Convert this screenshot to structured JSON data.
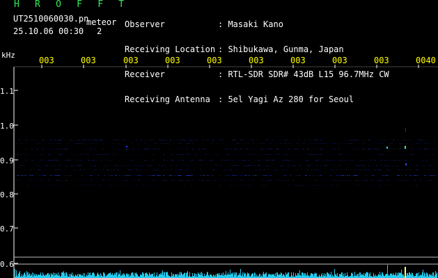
{
  "header": {
    "title": "H R O F F T",
    "filename": "UT2510060030.pn",
    "type_label": "meteor",
    "datetime": "25.10.06 00:30",
    "count": "2"
  },
  "info": {
    "labels": [
      "Observer",
      "Receiving Location",
      "Receiver",
      "Receiving Antenna"
    ],
    "values": [
      ": Masaki Kano",
      ": Shibukawa, Gunma, Japan",
      ": RTL-SDR SDR# 43dB L15 96.7MHz CW",
      ": 5el Yagi Az 280 for Seoul"
    ]
  },
  "axis": {
    "unit": "kHz",
    "time_labels": [
      "003",
      "003",
      "003",
      "003",
      "003",
      "003",
      "003",
      "003",
      "003",
      "0040"
    ],
    "freq_labels": [
      "1.1",
      "1.0",
      "0.9",
      "0.8",
      "0.7",
      "0.6"
    ]
  },
  "colors": {
    "title": "#33ee55",
    "time_labels": "#ffff00",
    "signal": "#2244ff",
    "meteor": "#33ff66",
    "noise_floor": "#22ccee"
  }
}
